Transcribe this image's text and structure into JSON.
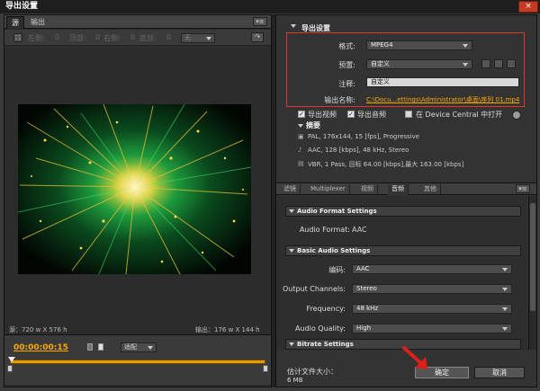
{
  "window": {
    "title": "导出设置",
    "close_label": "×"
  },
  "left": {
    "tabs": [
      "源",
      "输出"
    ],
    "menu_glyph": "▾≡",
    "toolbar": {
      "crop_glyph": "⛶",
      "left": "左侧:",
      "top": "顶部:",
      "right": "右侧:",
      "bottom": "底部:",
      "zero": "0",
      "ratio_value": "无",
      "arrow_glyph": "↷"
    },
    "source_size": "源：720 w X 576 h",
    "output_size": "输出：176 w X 144 h",
    "timecode": "00:00:00:15",
    "fit_value": "适配"
  },
  "right": {
    "section_title": "导出设置",
    "format_label": "格式:",
    "format_value": "MPEG4",
    "preset_label": "预置:",
    "preset_value": "自定义",
    "comment_label": "注释:",
    "comment_value": "自定义",
    "output_name_label": "输出名称:",
    "output_name_value": "C:\\Docu...ettings\\Administrator\\桌面\\序列 01.mp4",
    "export_video_label": "导出视频",
    "export_audio_label": "导出音频",
    "device_central_label": "在 Device Central 中打开",
    "summary_title": "摘要",
    "summary_lines": [
      "PAL, 176x144, 15 [fps], Progressive",
      "AAC, 128 [kbps], 48 kHz, Stereo",
      "VBR, 1 Pass, 目标 64.00 [kbps],最大 163.00 [kbps]"
    ],
    "subtabs": [
      "滤镜",
      "Multiplexer",
      "视频",
      "音频",
      "其他"
    ],
    "audio_format_section": "Audio Format Settings",
    "audio_format_label": "Audio Format:",
    "audio_format_value": "AAC",
    "basic_audio_section": "Basic Audio Settings",
    "codec_label": "编码:",
    "codec_value": "AAC",
    "channels_label": "Output Channels:",
    "channels_value": "Stereo",
    "frequency_label": "Frequency:",
    "frequency_value": "48 kHz",
    "quality_label": "Audio Quality:",
    "quality_value": "High",
    "bitrate_section": "Bitrate Settings",
    "filesize_label": "估计文件大小：",
    "filesize_value": "6 MB",
    "ok_label": "确定",
    "cancel_label": "取消"
  },
  "colors": {
    "accent": "#ffa800",
    "highlight_box": "#e0342c",
    "pointer_arrow": "#d9201a"
  }
}
